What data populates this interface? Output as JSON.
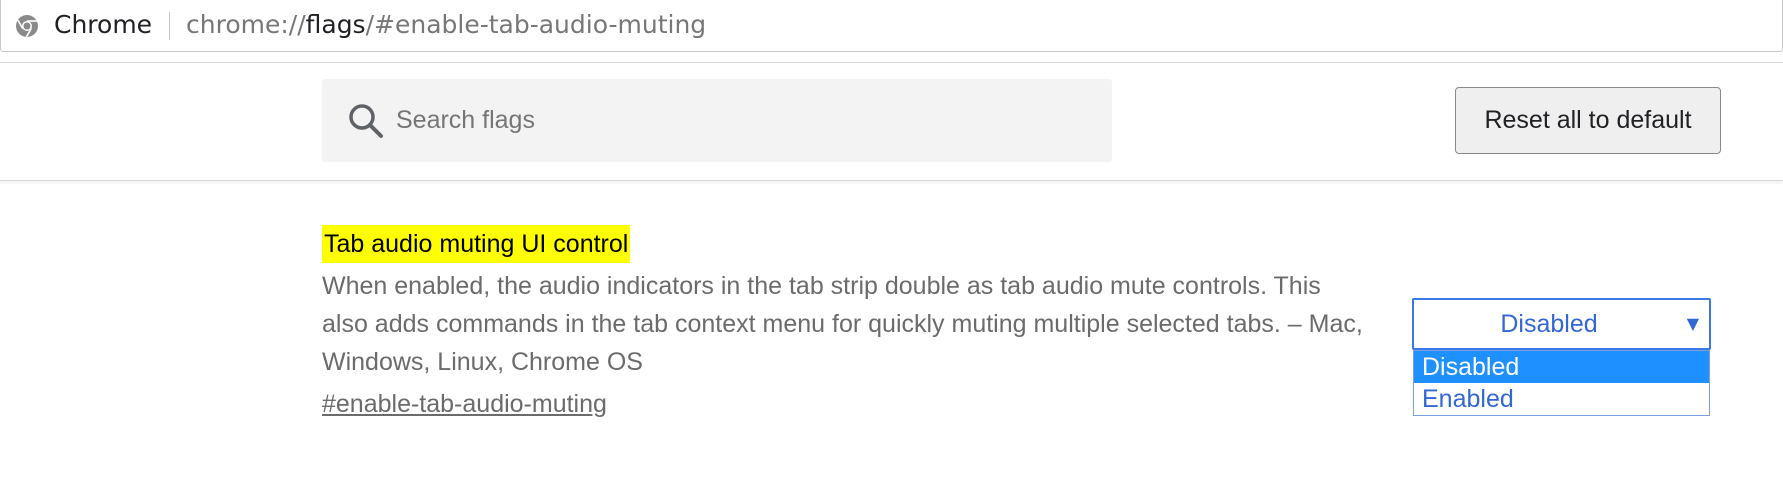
{
  "omnibox": {
    "chip_label": "Chrome",
    "url_scheme": "chrome://",
    "url_host": "flags",
    "url_path": "/#enable-tab-audio-muting",
    "icon": "chrome-logo-icon"
  },
  "header": {
    "search_placeholder": "Search flags",
    "search_value": "",
    "search_icon": "search-icon",
    "reset_label": "Reset all to default"
  },
  "flag": {
    "title": "Tab audio muting UI control",
    "description": "When enabled, the audio indicators in the tab strip double as tab audio mute controls. This also adds commands in the tab context menu for quickly muting multiple selected tabs. – Mac, Windows, Linux, Chrome OS",
    "anchor": "#enable-tab-audio-muting",
    "select": {
      "value": "Disabled",
      "arrow_icon": "dropdown-arrow-icon",
      "options": [
        "Disabled",
        "Enabled"
      ],
      "highlighted_option": "Disabled"
    }
  },
  "colors": {
    "title_highlight": "#ffff00",
    "select_accent": "#3367d6",
    "option_highlight": "#1e90ff"
  }
}
